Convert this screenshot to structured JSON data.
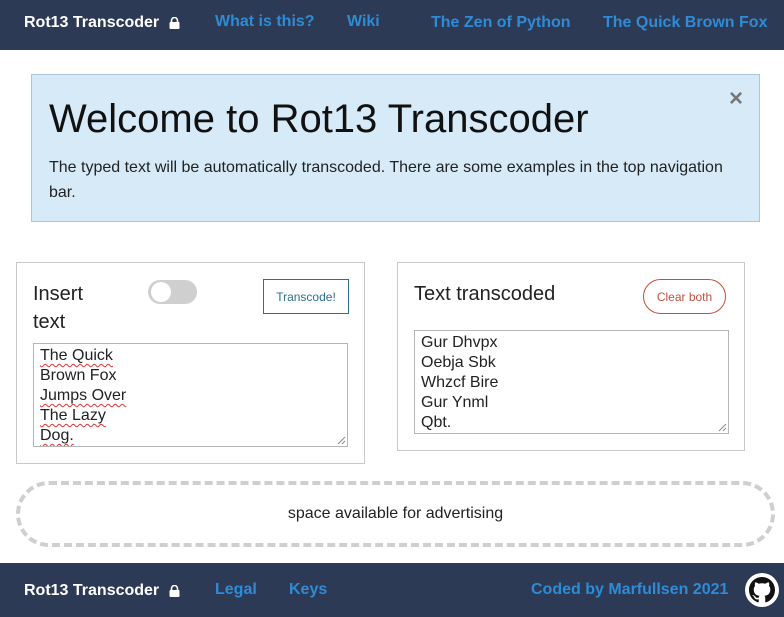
{
  "navbar": {
    "brand": "Rot13 Transcoder",
    "links": [
      "What is this?",
      "Wiki",
      "The Zen of Python",
      "The Quick Brown Fox"
    ]
  },
  "alert": {
    "title": "Welcome to Rot13 Transcoder",
    "text": "The typed text will be automatically transcoded. There are some examples in the top navigation bar.",
    "close": "×"
  },
  "input_panel": {
    "title_line1": "Insert",
    "title_line2": "text",
    "button": "Transcode!",
    "toggle_on": false,
    "lines": [
      "The Quick",
      "Brown Fox",
      "Jumps Over",
      "The Lazy",
      "Dog."
    ]
  },
  "output_panel": {
    "title": "Text transcoded",
    "button": "Clear both",
    "lines": [
      "Gur Dhvpx",
      "Oebja Sbk",
      "Whzcf Bire",
      "Gur Ynml",
      "Qbt."
    ]
  },
  "ad": {
    "text": "space available for advertising"
  },
  "footer": {
    "brand": "Rot13 Transcoder",
    "links": [
      "Legal",
      "Keys"
    ],
    "credit": "Coded by Marfullsen 2021"
  },
  "colors": {
    "navbar_bg": "#2d3a55",
    "link": "#2e8bd6",
    "alert_bg": "#d6eaf8",
    "transcode_btn": "#2d6f8e",
    "clear_btn": "#c0513f"
  },
  "icons": [
    "lock-icon",
    "close-icon",
    "github-icon",
    "resize-grip-icon"
  ]
}
